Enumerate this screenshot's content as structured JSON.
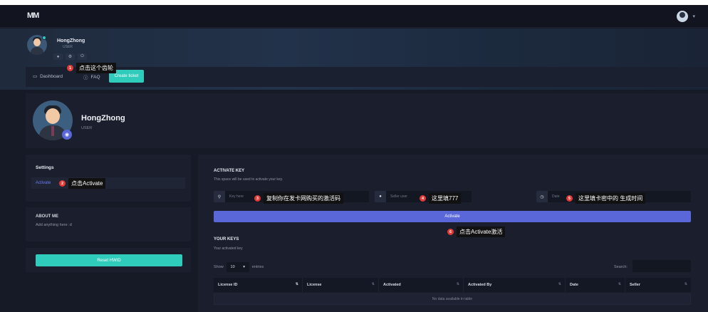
{
  "navbar": {
    "logo": "MM",
    "avatar_caret": "▾"
  },
  "banner": {
    "name": "HongZhong",
    "role": "USER",
    "icons": [
      "user-icon",
      "gear-icon",
      "power-icon"
    ]
  },
  "tabs": {
    "dashboard": "Dashboard",
    "faq": "FAQ",
    "create_ticket": "Create ticket"
  },
  "profile": {
    "name": "HongZhong",
    "role": "USER"
  },
  "settings": {
    "title": "Settings",
    "activate_link": "Activate"
  },
  "about": {
    "title": "ABOUT ME",
    "text": "Add anything here :d"
  },
  "reset": {
    "button": "Reset HWID"
  },
  "activate_key": {
    "title": "ACTIVATE KEY",
    "subtitle": "This space will be used to activate your key.",
    "key_placeholder": "Key here",
    "seller_placeholder": "Seller user",
    "date_placeholder": "Date",
    "button": "Activate"
  },
  "your_keys": {
    "title": "YOUR KEYS",
    "subtitle": "Your activated key",
    "show_label": "Show",
    "entries_value": "10",
    "entries_label": "entries",
    "search_label": "Search:",
    "columns": [
      "License ID",
      "License",
      "Activated",
      "Activated By",
      "Date",
      "Seller"
    ],
    "empty": "No data available in table"
  },
  "annotations": [
    {
      "num": "1",
      "text": "点击这个齿轮"
    },
    {
      "num": "2",
      "text": "点击Activate"
    },
    {
      "num": "3",
      "text": "复制你在发卡网购买的激活码"
    },
    {
      "num": "4",
      "text": "这里填777"
    },
    {
      "num": "5",
      "text": "这里填卡密中的 生成时间"
    },
    {
      "num": "6",
      "text": "点击Activate激活"
    }
  ],
  "colors": {
    "accent_teal": "#2fcbbb",
    "accent_indigo": "#5a67d8",
    "annotation_red": "#e53935"
  }
}
